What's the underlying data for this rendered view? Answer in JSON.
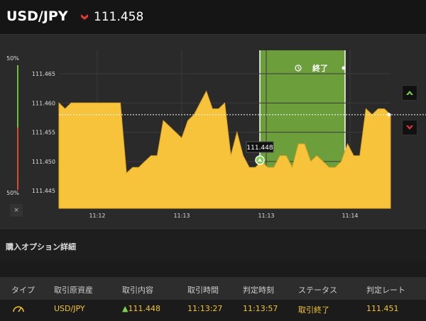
{
  "header": {
    "pair": "USD/JPY",
    "direction_icon": "down-arrow-red",
    "rate": "111.458"
  },
  "gauge": {
    "top_pct": "50%",
    "bottom_pct": "50%",
    "close_label": "×"
  },
  "expiry": {
    "clock_icon": "clock-icon",
    "label": "終了"
  },
  "current_point": {
    "label": "111.448"
  },
  "chart_data": {
    "type": "area",
    "ylim": [
      111.442,
      111.469
    ],
    "yticks": [
      "111.465",
      "111.460",
      "111.455",
      "111.450",
      "111.445"
    ],
    "xticks": [
      "11:12",
      "11:13",
      "11:13",
      "11:14"
    ],
    "current_level": 111.458,
    "colors": {
      "area": "#f7c33b",
      "highlight": "#6c9e3c"
    },
    "series": [
      {
        "values": [
          111.46,
          111.459,
          111.46,
          111.46,
          111.46,
          111.46,
          111.46,
          111.46,
          111.46,
          111.46,
          111.46,
          111.448,
          111.449,
          111.449,
          111.45,
          111.451,
          111.451,
          111.457,
          111.456,
          111.455,
          111.454,
          111.457,
          111.458,
          111.46,
          111.462,
          111.459,
          111.459,
          111.46,
          111.451,
          111.455,
          111.451,
          111.449,
          111.449,
          111.45,
          111.449,
          111.449,
          111.451,
          111.451,
          111.449,
          111.453,
          111.453,
          111.45,
          111.451,
          111.45,
          111.449,
          111.449,
          111.45,
          111.453,
          111.451,
          111.451,
          111.459,
          111.458,
          111.459,
          111.459,
          111.458
        ]
      }
    ]
  },
  "side_buttons": {
    "up_icon": "up-arrow-green",
    "down_icon": "down-arrow-red"
  },
  "section": {
    "title": "購入オプション詳細"
  },
  "table": {
    "headers": [
      "タイプ",
      "取引原資産",
      "取引内容",
      "取引時間",
      "判定時刻",
      "ステータス",
      "判定レート"
    ],
    "row": {
      "type_icon": "gauge-icon",
      "asset": "USD/JPY",
      "content": "111.448",
      "trade_time": "11:13:27",
      "judge_time": "11:13:57",
      "status": "取引終了",
      "judge_rate": "111.451"
    }
  }
}
